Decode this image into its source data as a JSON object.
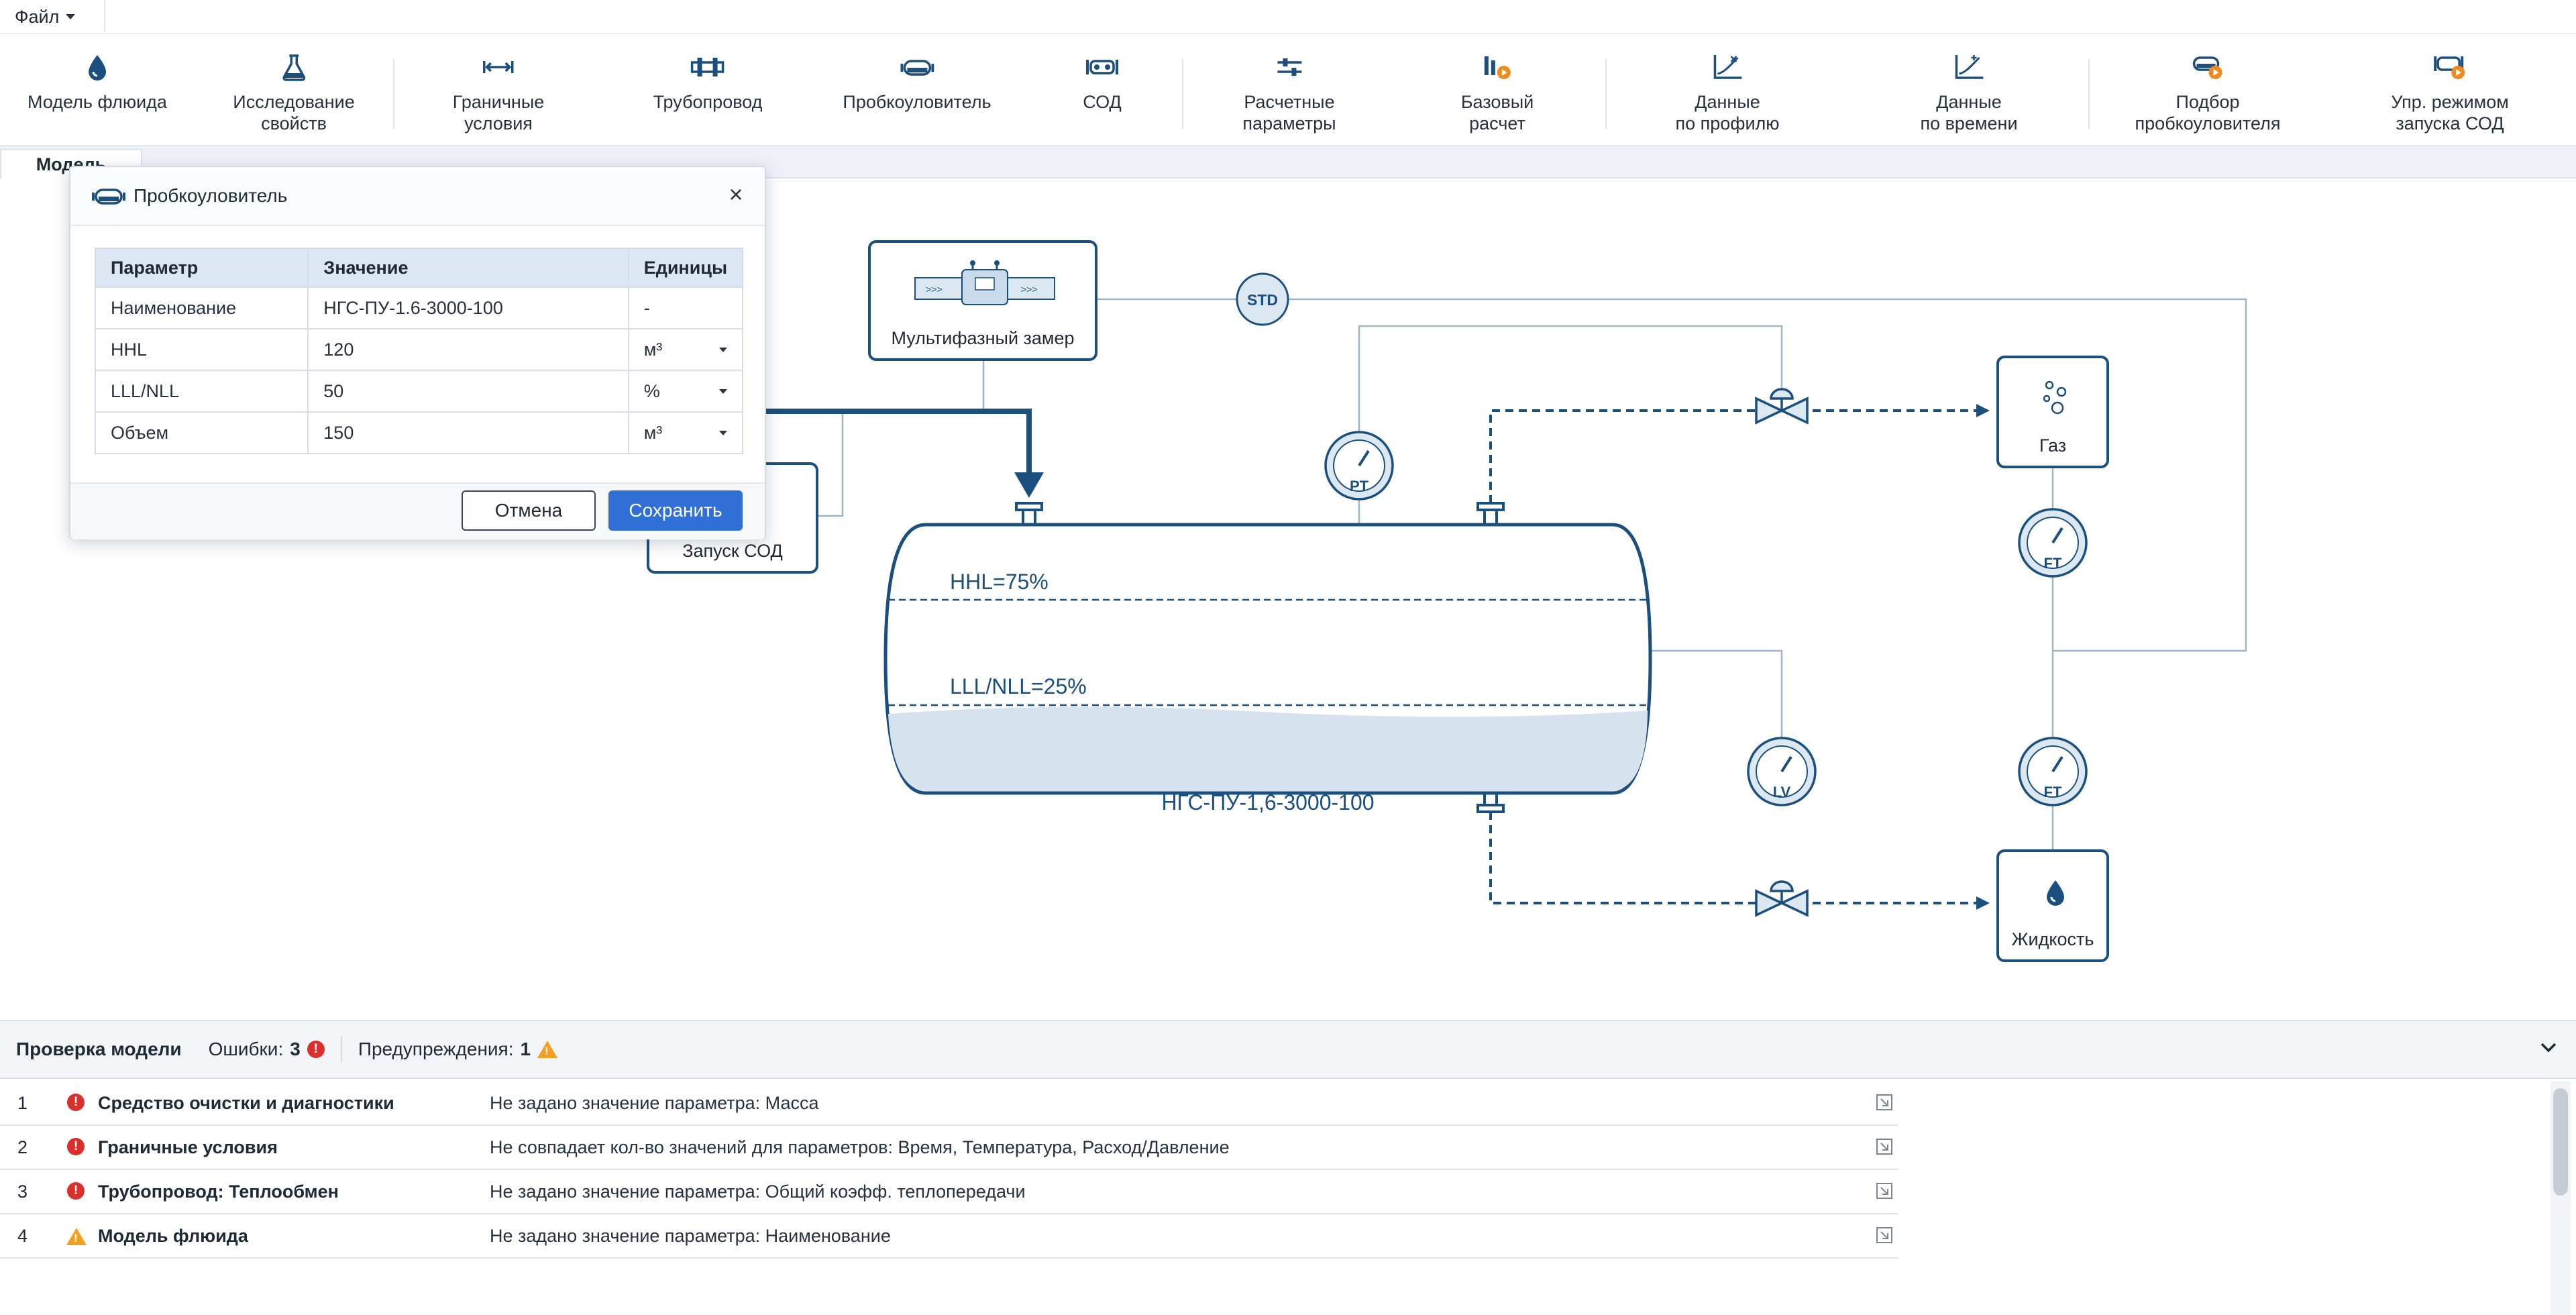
{
  "menu": {
    "file_label": "Файл"
  },
  "toolbar": {
    "items": [
      {
        "label": "Модель флюида",
        "icon": "droplet-icon"
      },
      {
        "label": "Исследование\nсвойств",
        "icon": "flask-icon"
      },
      {
        "label": "Граничные\nусловия",
        "icon": "boundary-icon"
      },
      {
        "label": "Трубопровод",
        "icon": "pipeline-icon"
      },
      {
        "label": "Пробкоуловитель",
        "icon": "slug-catcher-icon"
      },
      {
        "label": "СОД",
        "icon": "pig-icon"
      },
      {
        "label": "Расчетные\nпараметры",
        "icon": "sliders-icon"
      },
      {
        "label": "Базовый\nрасчет",
        "icon": "base-calc-icon"
      },
      {
        "label": "Данные\nпо профилю",
        "icon": "profile-chart-icon"
      },
      {
        "label": "Данные\nпо времени",
        "icon": "time-chart-icon"
      },
      {
        "label": "Подбор\nпробкоуловителя",
        "icon": "slug-catcher-select-icon"
      },
      {
        "label": "Упр. режимом\nзапуска СОД",
        "icon": "pig-launch-control-icon"
      }
    ]
  },
  "tabs": [
    {
      "label": "Модель"
    }
  ],
  "diagram": {
    "meter_label": "Мультифазный замер",
    "std_label": "STD",
    "pig_launch_label": "Запуск СОД",
    "hhl_label": "HHL=75%",
    "lll_label": "LLL/NLL=25%",
    "vessel_label": "НГС-ПУ-1,6-3000-100",
    "gas_label": "Газ",
    "liquid_label": "Жидкость",
    "pt_label": "PT",
    "ft_label": "FT",
    "lv_label": "LV",
    "hhl_percent": 75,
    "lll_percent": 25,
    "colors": {
      "line": "#1a4f7f",
      "thin_line": "#9fb6c9",
      "liquid": "#d6e3ee"
    }
  },
  "dialog": {
    "title": "Пробкоуловитель",
    "headers": {
      "param": "Параметр",
      "value": "Значение",
      "unit": "Единицы"
    },
    "rows": [
      {
        "param": "Наименование",
        "value": "НГС-ПУ-1.6-3000-100",
        "unit": "-"
      },
      {
        "param": "HHL",
        "value": "120",
        "unit": "м³"
      },
      {
        "param": "LLL/NLL",
        "value": "50",
        "unit": "%"
      },
      {
        "param": "Объем",
        "value": "150",
        "unit": "м³"
      }
    ],
    "cancel_label": "Отмена",
    "save_label": "Сохранить"
  },
  "check_panel": {
    "title": "Проверка модели",
    "errors_label": "Ошибки:",
    "errors_count": "3",
    "warnings_label": "Предупреждения:",
    "warnings_count": "1",
    "rows": [
      {
        "num": "1",
        "status": "error",
        "source": "Средство очистки и диагностики",
        "message": "Не задано значение параметра: Масса"
      },
      {
        "num": "2",
        "status": "error",
        "source": "Граничные условия",
        "message": "Не совпадает кол-во значений для параметров: Время, Температура, Расход/Давление"
      },
      {
        "num": "3",
        "status": "error",
        "source": "Трубопровод: Теплообмен",
        "message": "Не задано значение параметра: Общий коэфф. теплопередачи"
      },
      {
        "num": "4",
        "status": "warning",
        "source": "Модель флюида",
        "message": "Не задано значение параметра: Наименование"
      }
    ]
  }
}
